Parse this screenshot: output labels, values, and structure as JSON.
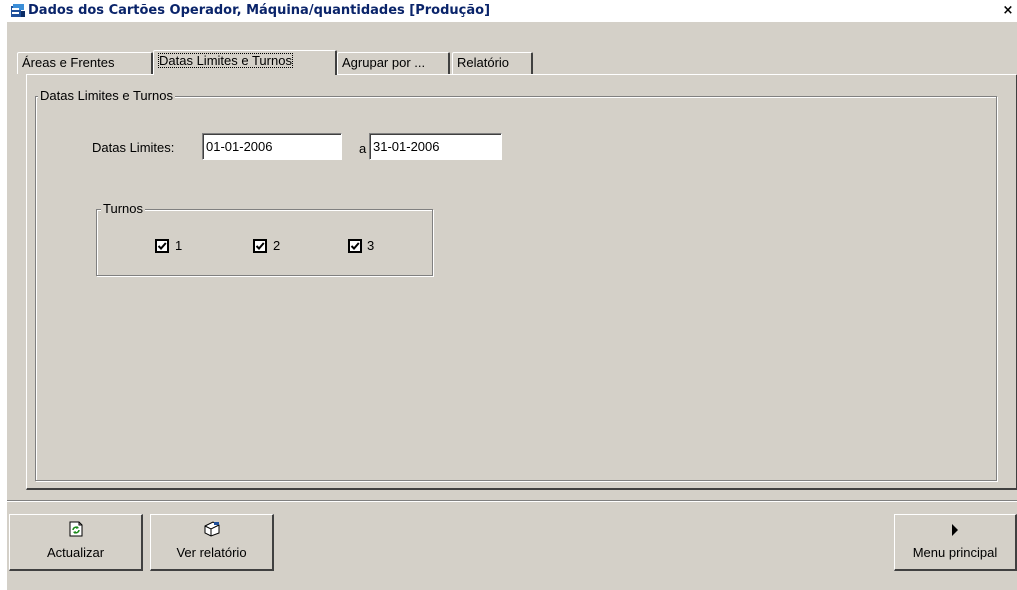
{
  "window": {
    "title": "Dados dos Cartões Operador, Máquina/quantidades [Produção]",
    "close_label": "×"
  },
  "tabs": [
    {
      "label": "Áreas e Frentes"
    },
    {
      "label": "Datas Limites e Turnos",
      "active": true
    },
    {
      "label": "Agrupar por ..."
    },
    {
      "label": "Relatório"
    }
  ],
  "datas_group": {
    "title": "Datas Limites e Turnos",
    "date_label": "Datas Limites:",
    "date_from": "01-01-2006",
    "separator": "a",
    "date_to": "31-01-2006"
  },
  "turnos_group": {
    "title": "Turnos",
    "items": [
      {
        "label": "1",
        "checked": true
      },
      {
        "label": "2",
        "checked": true
      },
      {
        "label": "3",
        "checked": true
      }
    ]
  },
  "buttons": {
    "refresh_label": "Actualizar",
    "report_label": "Ver relatório",
    "menu_label": "Menu principal"
  }
}
